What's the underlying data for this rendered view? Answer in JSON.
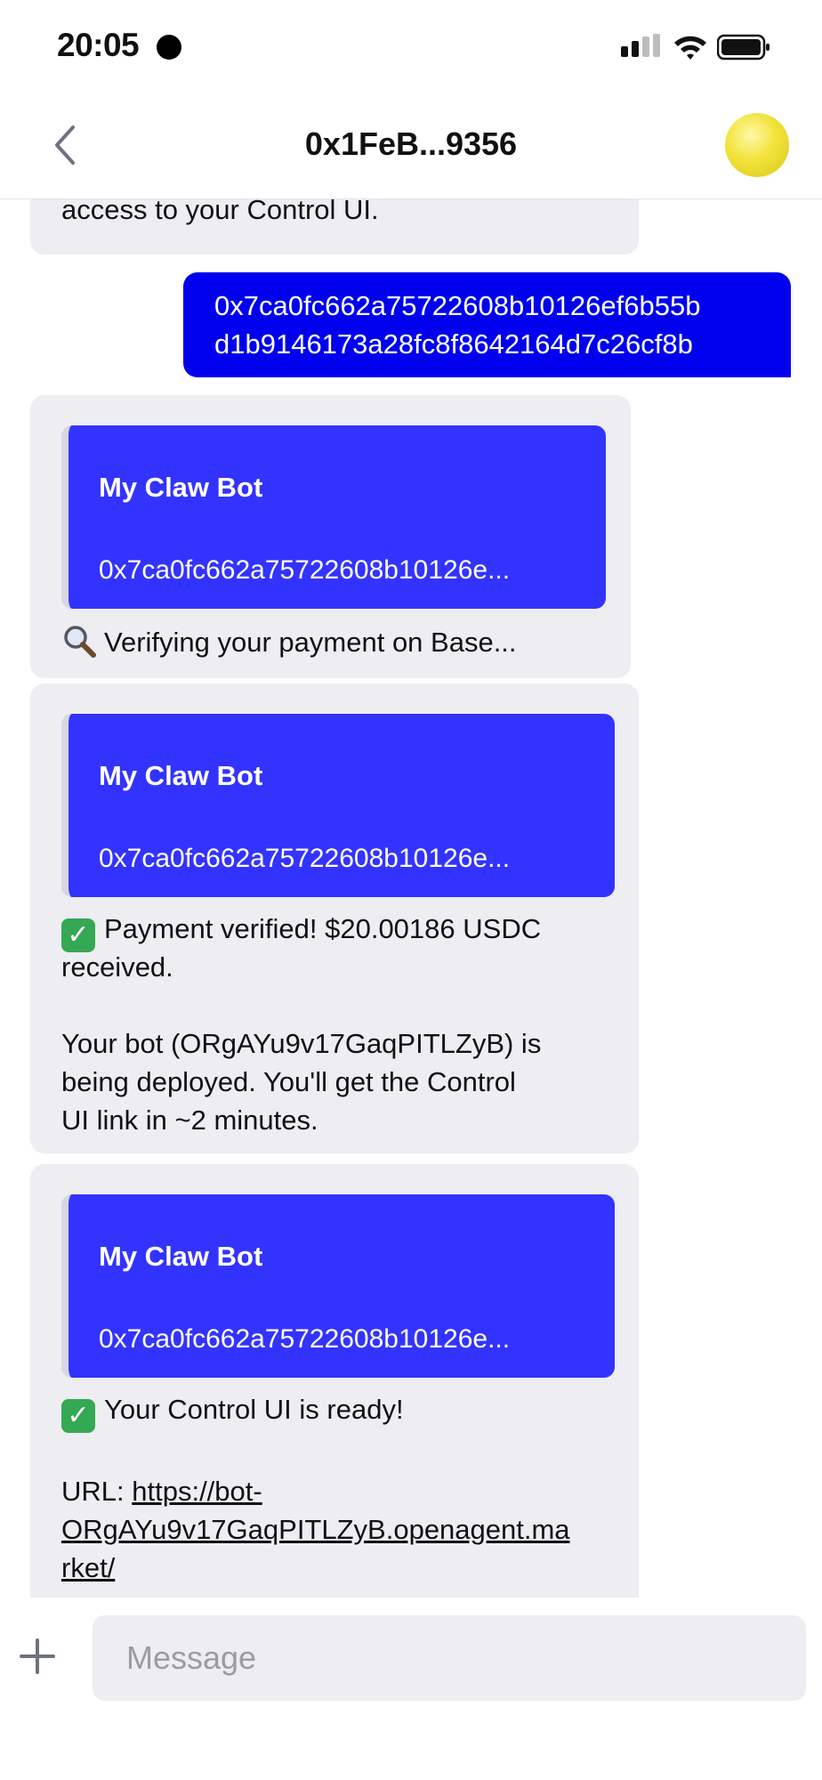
{
  "status_bar": {
    "time": "20:05"
  },
  "header": {
    "title": "0x1FeB...9356"
  },
  "messages": [
    {
      "type": "in_partial",
      "text": "access to your Control UI."
    },
    {
      "type": "out",
      "text_line1": "0x7ca0fc662a75722608b10126ef6b55b",
      "text_line2": "d1b9146173a28fc8f8642164d7c26cf8b"
    },
    {
      "type": "in",
      "card_title": "My Claw Bot",
      "card_subtitle": "0x7ca0fc662a75722608b10126e...",
      "text": "Verifying your payment on Base..."
    },
    {
      "type": "in",
      "card_title": "My Claw Bot",
      "card_subtitle": "0x7ca0fc662a75722608b10126e...",
      "text_line1": "Payment verified! $20.00186 USDC",
      "text_line2": "received.",
      "text_para2_line1": "Your bot (ORgAYu9v17GaqPITLZyB) is",
      "text_para2_line2": "being deployed. You'll get the Control",
      "text_para2_line3": "UI link in ~2 minutes."
    },
    {
      "type": "in",
      "card_title": "My Claw Bot",
      "card_subtitle": "0x7ca0fc662a75722608b10126e...",
      "text": "Your Control UI is ready!",
      "url_label": "URL: ",
      "url_line1": "https://bot-",
      "url_line2": "ORgAYu9v17GaqPITLZyB.openagent.ma",
      "url_line3": "rket/"
    }
  ],
  "composer": {
    "placeholder": "Message"
  },
  "icons": {
    "back": "chevron-left-icon",
    "plus": "plus-icon",
    "search": "magnifier-emoji",
    "check": "check-emoji",
    "signal": "cellular-signal-icon",
    "wifi": "wifi-icon",
    "battery": "battery-icon"
  },
  "colors": {
    "outgoing_bubble": "#0000ee",
    "card": "#3333ff",
    "incoming_bubble": "#ededf2",
    "check": "#34a853"
  }
}
